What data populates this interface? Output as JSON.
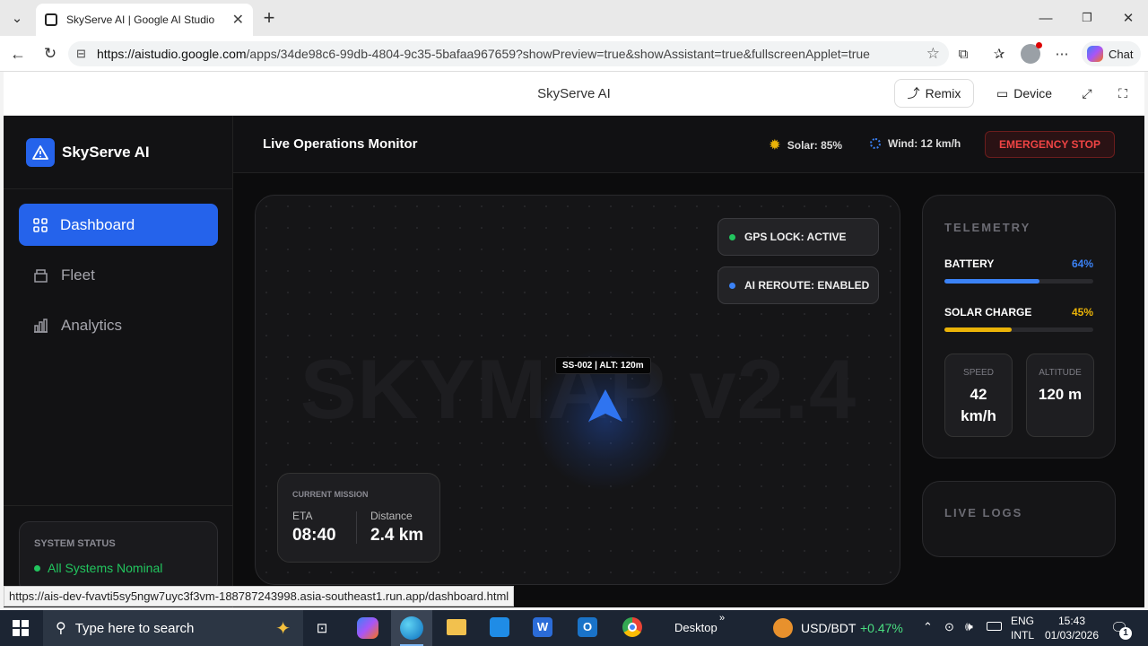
{
  "browser": {
    "tab_title": "SkyServe AI | Google AI Studio",
    "url_host": "https://aistudio.google.com",
    "url_path": "/apps/34de98c6-99db-4804-9c35-5bafaa967659?showPreview=true&showAssistant=true&fullscreenApplet=true",
    "chat_label": "Chat",
    "status_url": "https://ais-dev-fvavti5sy5ngw7uyc3f3vm-188787243998.asia-southeast1.run.app/dashboard.html"
  },
  "studio": {
    "title": "SkyServe AI",
    "remix_label": "Remix",
    "device_label": "Device"
  },
  "app": {
    "brand": "SkyServe AI",
    "nav": [
      {
        "label": "Dashboard"
      },
      {
        "label": "Fleet"
      },
      {
        "label": "Analytics"
      }
    ],
    "system_status": {
      "title": "SYSTEM STATUS",
      "value": "All Systems Nominal"
    },
    "header": {
      "title": "Live Operations Monitor",
      "solar": "Solar: 85%",
      "wind": "Wind: 12 km/h",
      "emergency": "EMERGENCY STOP"
    },
    "map": {
      "watermark": "SKYMAP v2.4",
      "gps": "GPS LOCK: ACTIVE",
      "reroute": "AI REROUTE: ENABLED",
      "drone_label": "SS-002 | ALT: 120m",
      "mission": {
        "title": "CURRENT MISSION",
        "eta_label": "ETA",
        "eta_value": "08:40",
        "distance_label": "Distance",
        "distance_value": "2.4 km"
      }
    },
    "telemetry": {
      "title": "TELEMETRY",
      "battery_label": "BATTERY",
      "battery_text": "64%",
      "battery_value": 0.64,
      "solar_label": "SOLAR CHARGE",
      "solar_text": "45%",
      "solar_value": 0.45,
      "speed_label": "SPEED",
      "speed_value": "42",
      "speed_unit": "km/h",
      "altitude_label": "ALTITUDE",
      "altitude_value": "120 m"
    },
    "logs": {
      "title": "LIVE LOGS"
    }
  },
  "taskbar": {
    "search_placeholder": "Type here to search",
    "desktop_label": "Desktop",
    "currency": "USD/BDT",
    "currency_change": "+0.47%",
    "lang1": "ENG",
    "lang2": "INTL",
    "time": "15:43",
    "date": "01/03/2026",
    "notification_count": "1"
  },
  "colors": {
    "accent": "#2563eb",
    "battery": "#3b82f6",
    "solar": "#eab308",
    "emergency": "#ef4444",
    "nominal": "#22c55e"
  }
}
